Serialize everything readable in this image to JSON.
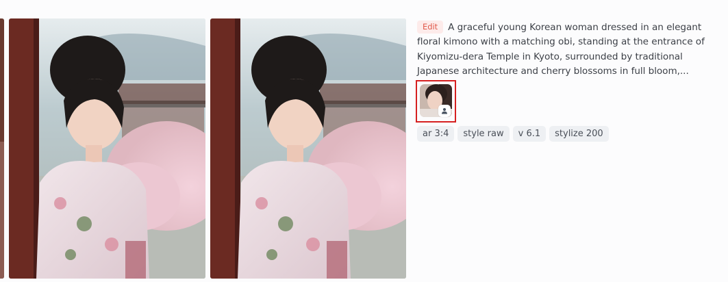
{
  "images": [
    {
      "name": "generated-image-partial",
      "alt": ""
    },
    {
      "name": "generated-image-1",
      "alt": ""
    },
    {
      "name": "generated-image-2",
      "alt": ""
    }
  ],
  "prompt": {
    "edit_label": "Edit",
    "text": "A graceful young Korean woman dressed in an elegant floral kimono with a matching obi, standing at the entrance of Kiyomizu-dera Temple in Kyoto, surrounded by traditional Japanese architecture and cherry blossoms in full bloom,..."
  },
  "reference": {
    "badge_icon": "person-icon"
  },
  "parameters": [
    {
      "label": "ar 3:4"
    },
    {
      "label": "style raw"
    },
    {
      "label": "v 6.1"
    },
    {
      "label": "stylize 200"
    }
  ],
  "colors": {
    "edit_accent": "#e0584a",
    "highlight_border": "#d61f1f",
    "chip_bg": "#eef0f3"
  }
}
